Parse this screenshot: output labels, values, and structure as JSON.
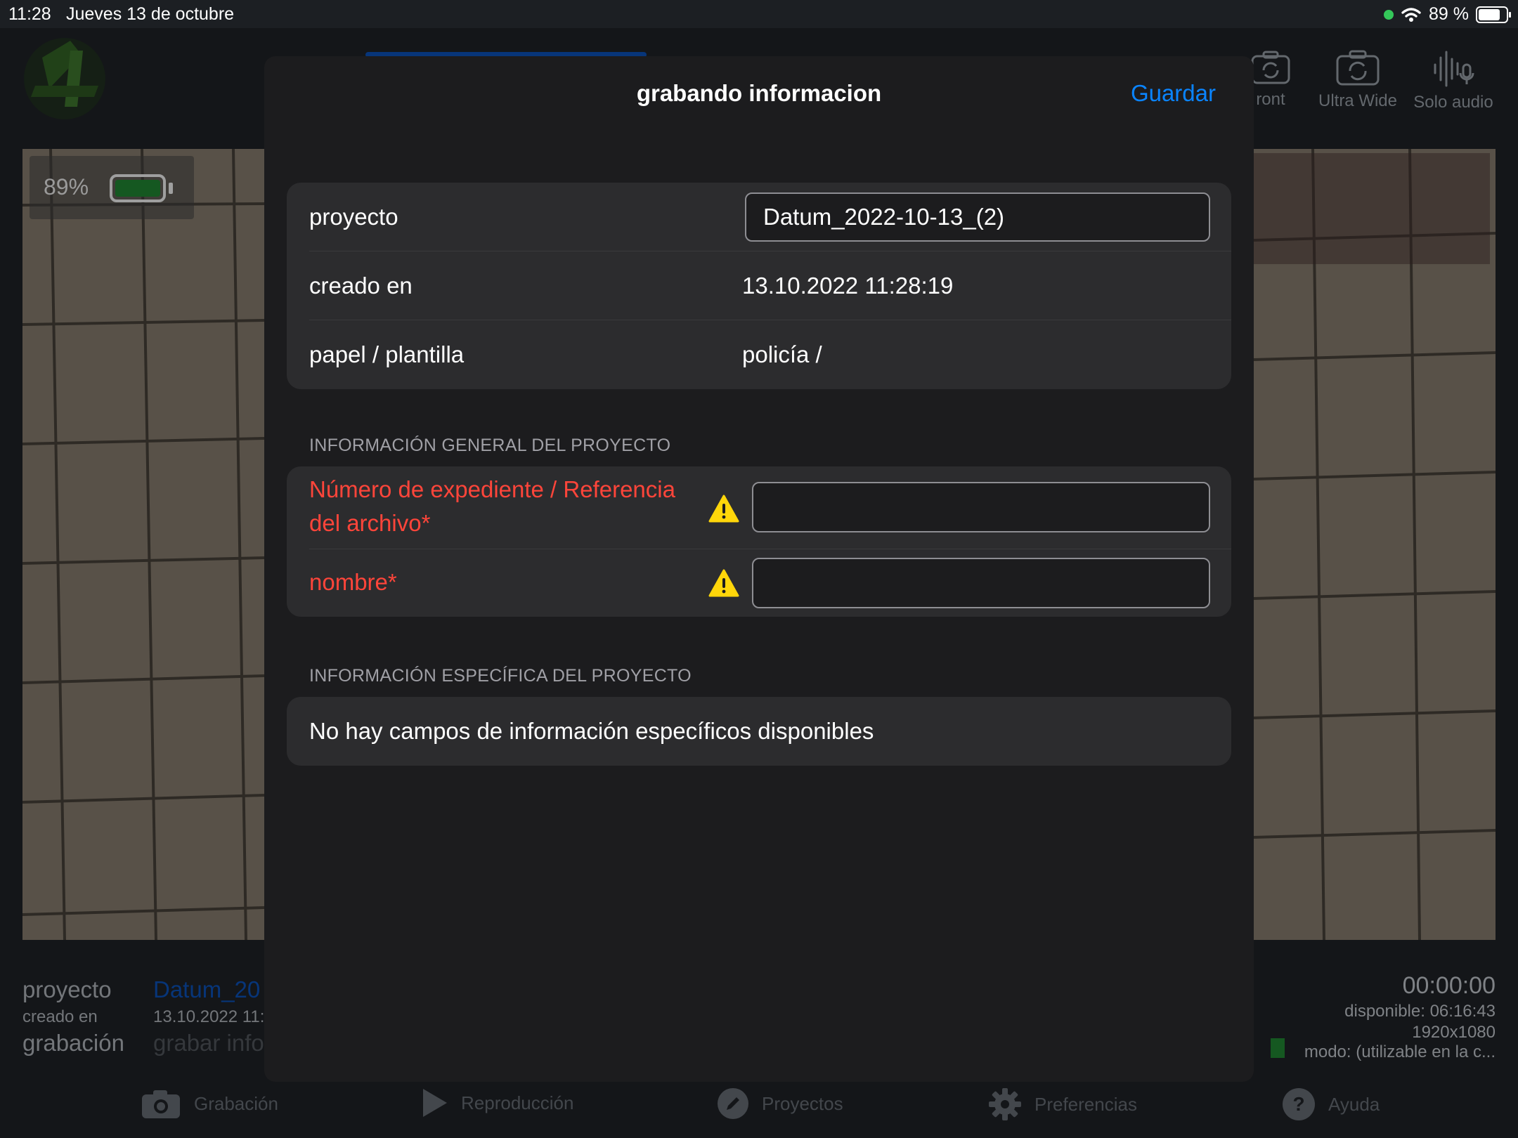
{
  "status": {
    "time": "11:28",
    "date": "Jueves 13 de octubre",
    "battery_text": "89 %",
    "battery_level": 0.89
  },
  "background": {
    "camera_buttons": [
      {
        "label": "ront",
        "icon": "camera-rotate-icon"
      },
      {
        "label": "Ultra Wide",
        "icon": "camera-rotate-icon"
      },
      {
        "label": "Solo audio",
        "icon": "audio-waveform-icon"
      }
    ],
    "preview_battery_pct": "89%",
    "info": {
      "project_label": "proyecto",
      "created_label": "creado en",
      "recording_label": "grabación",
      "project_value": "Datum_20",
      "created_value": "13.10.2022 11:",
      "record_info_link": "grabar info",
      "timer": "00:00:00",
      "available": "disponible: 06:16:43",
      "resolution": "1920x1080",
      "mode": "modo: (utilizable en la c..."
    },
    "tabs": [
      {
        "label": "Grabación",
        "icon": "camera-icon"
      },
      {
        "label": "Reproducción",
        "icon": "play-icon"
      },
      {
        "label": "Proyectos",
        "icon": "pencil-icon"
      },
      {
        "label": "Preferencias",
        "icon": "gear-icon"
      },
      {
        "label": "Ayuda",
        "icon": "question-icon"
      }
    ]
  },
  "modal": {
    "title": "grabando informacion",
    "save_label": "Guardar",
    "summary": {
      "project_label": "proyecto",
      "project_value": "Datum_2022-10-13_(2)",
      "created_label": "creado en",
      "created_value": "13.10.2022 11:28:19",
      "paper_label": "papel / plantilla",
      "paper_value": "policía /"
    },
    "general": {
      "header": "INFORMACIÓN GENERAL DEL PROYECTO",
      "file_number_label_1": "Número de expediente / Referencia",
      "file_number_label_2": "del archivo*",
      "file_number_value": "",
      "name_label": "nombre*",
      "name_value": ""
    },
    "specific": {
      "header": "INFORMACIÓN ESPECÍFICA DEL PROYECTO",
      "empty_text": "No hay campos de información específicos disponibles"
    }
  },
  "colors": {
    "accent": "#0a84ff",
    "required": "#ff453a",
    "warning": "#ffd60a",
    "modal_bg": "#1c1c1e",
    "group_bg": "#2c2c2e"
  }
}
